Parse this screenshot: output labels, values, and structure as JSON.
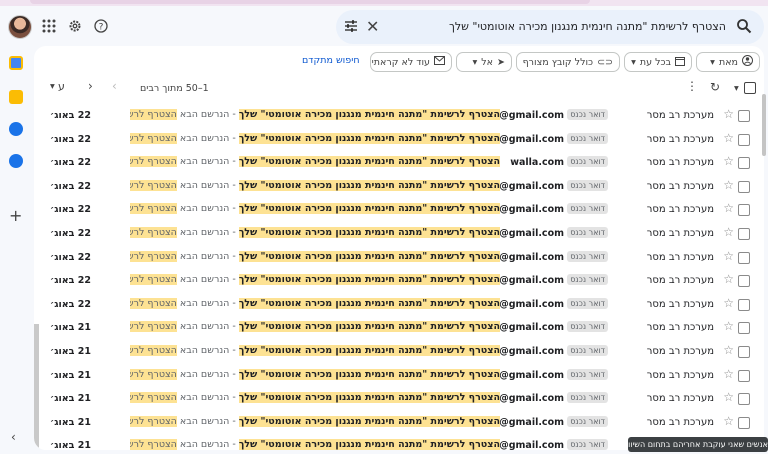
{
  "header": {
    "search_query": "הצטרף לרשימת \"מתנה חינמית מנגנון מכירה אוטומטי\" שלך",
    "icons": [
      "avatar",
      "apps-grid-icon",
      "settings-icon",
      "help-icon",
      "search-options-icon",
      "clear-search-icon",
      "search-icon"
    ]
  },
  "filters": {
    "from": "מאת",
    "any_time": "בכל עת",
    "has_attachment": "כולל קובץ מצורף",
    "to": "אל",
    "unread": "עוד לא קראתי",
    "advanced": "חיפוש מתקדם"
  },
  "toolbar": {
    "range": "1–50 מתוך רבים",
    "lang": "ע"
  },
  "rows": [
    {
      "sender": "מערכת רב מסר",
      "tag": "דואר נכנס",
      "email": "@gmail.com",
      "snippet_bold": "הצטרף לרשימת \"מתנה חינמית מנגנון מכירה אוטומטי\" שלך",
      "snippet_rest": " - הנרשם הבא ",
      "snippet_hl": "הצטרף לרשימת \"מ...",
      "date": "22 באוג׳"
    },
    {
      "sender": "מערכת רב מסר",
      "tag": "דואר נכנס",
      "email": "@gmail.com",
      "snippet_bold": "הצטרף לרשימת \"מתנה חינמית מנגנון מכירה אוטומטי\" שלך",
      "snippet_rest": " - הנרשם הבא ",
      "snippet_hl": "הצטרף לרשימת \"מ...",
      "date": "22 באוג׳"
    },
    {
      "sender": "מערכת רב מסר",
      "tag": "דואר נכנס",
      "email": "walla.com",
      "snippet_bold": "הצטרף לרשימת \"מתנה חינמית מנגנון מכירה אוטומטי\" שלך",
      "snippet_rest": " - הנרשם הבא ",
      "snippet_hl": "הצטרף לרשימת \"מתנ...",
      "date": "22 באוג׳"
    },
    {
      "sender": "מערכת רב מסר",
      "tag": "דואר נכנס",
      "email": "@gmail.com",
      "snippet_bold": "הצטרף לרשימת \"מתנה חינמית מנגנון מכירה אוטומטי\" שלך",
      "snippet_rest": " - הנרשם הבא ",
      "snippet_hl": "הצטרף לרשימת \"...",
      "date": "22 באוג׳"
    },
    {
      "sender": "מערכת רב מסר",
      "tag": "דואר נכנס",
      "email": "@gmail.com",
      "snippet_bold": "הצטרף לרשימת \"מתנה חינמית מנגנון מכירה אוטומטי\" שלך",
      "snippet_rest": " - הנרשם הבא ",
      "snippet_hl": "הצטרף לרשימת...",
      "date": "22 באוג׳"
    },
    {
      "sender": "מערכת רב מסר",
      "tag": "דואר נכנס",
      "email": "@gmail.com",
      "snippet_bold": "הצטרף לרשימת \"מתנה חינמית מנגנון מכירה אוטומטי\" שלך",
      "snippet_rest": " - הנרשם הבא ",
      "snippet_hl": "הצטרף לרשימת \"...",
      "date": "22 באוג׳"
    },
    {
      "sender": "מערכת רב מסר",
      "tag": "דואר נכנס",
      "email": "@gmail.com",
      "snippet_bold": "הצטרף לרשימת \"מתנה חינמית מנגנון מכירה אוטומטי\" שלך",
      "snippet_rest": " - הנרשם הבא ",
      "snippet_hl": "הצטרף לרשי...",
      "date": "22 באוג׳"
    },
    {
      "sender": "מערכת רב מסר",
      "tag": "דואר נכנס",
      "email": "@gmail.com",
      "snippet_bold": "הצטרף לרשימת \"מתנה חינמית מנגנון מכירה אוטומטי\" שלך",
      "snippet_rest": " - הנרשם הבא ",
      "snippet_hl": "הצטרף לרשימת...",
      "date": "22 באוג׳"
    },
    {
      "sender": "מערכת רב מסר",
      "tag": "דואר נכנס",
      "email": "@gmail.com",
      "snippet_bold": "הצטרף לרשימת \"מתנה חינמית מנגנון מכירה אוטומטי\" שלך",
      "snippet_rest": " - הנרשם הבא ",
      "snippet_hl": "הצטרף לרשימת \"מ...",
      "date": "22 באוג׳"
    },
    {
      "sender": "מערכת רב מסר",
      "tag": "דואר נכנס",
      "email": "@gmail.com",
      "snippet_bold": "הצטרף לרשימת \"מתנה חינמית מנגנון מכירה אוטומטי\" שלך",
      "snippet_rest": " - הנרשם הבא ",
      "snippet_hl": "הצטרף לרשימת \"...",
      "date": "21 באוג׳"
    },
    {
      "sender": "מערכת רב מסר",
      "tag": "דואר נכנס",
      "email": "@gmail.com",
      "snippet_bold": "הצטרף לרשימת \"מתנה חינמית מנגנון מכירה אוטומטי\" שלך",
      "snippet_rest": " - הנרשם הבא ",
      "snippet_hl": "הצטרף לרשימת...",
      "date": "21 באוג׳"
    },
    {
      "sender": "מערכת רב מסר",
      "tag": "דואר נכנס",
      "email": "@gmail.com",
      "snippet_bold": "הצטרף לרשימת \"מתנה חינמית מנגנון מכירה אוטומטי\" שלך",
      "snippet_rest": " - הנרשם הבא ",
      "snippet_hl": "הצטרף לרשימת \"...",
      "date": "21 באוג׳"
    },
    {
      "sender": "מערכת רב מסר",
      "tag": "דואר נכנס",
      "email": "@gmail.com",
      "snippet_bold": "הצטרף לרשימת \"מתנה חינמית מנגנון מכירה אוטומטי\" שלך",
      "snippet_rest": " - הנרשם הבא ",
      "snippet_hl": "הצטרף לרשימ...",
      "date": "21 באוג׳"
    },
    {
      "sender": "מערכת רב מסר",
      "tag": "דואר נכנס",
      "email": "@gmail.com",
      "snippet_bold": "הצטרף לרשימת \"מתנה חינמית מנגנון מכירה אוטומטי\" שלך",
      "snippet_rest": " - הנרשם הבא ",
      "snippet_hl": "הצטרף לרשימת \"מ...",
      "date": "21 באוג׳"
    },
    {
      "sender": "מערכת רב מסר",
      "tag": "דואר נכנס",
      "email": "@gmail.com",
      "snippet_bold": "הצטרף לרשימת \"מתנה חינמית מנגנון מכירה אוטומטי\" שלך",
      "snippet_rest": " - הנרשם הבא ",
      "snippet_hl": "הצטרף לרשימת \"מת...",
      "date": "21 באוג׳"
    }
  ],
  "tooltip": "אנשים שאני עוקבת אחריהם בתחום השיווק"
}
